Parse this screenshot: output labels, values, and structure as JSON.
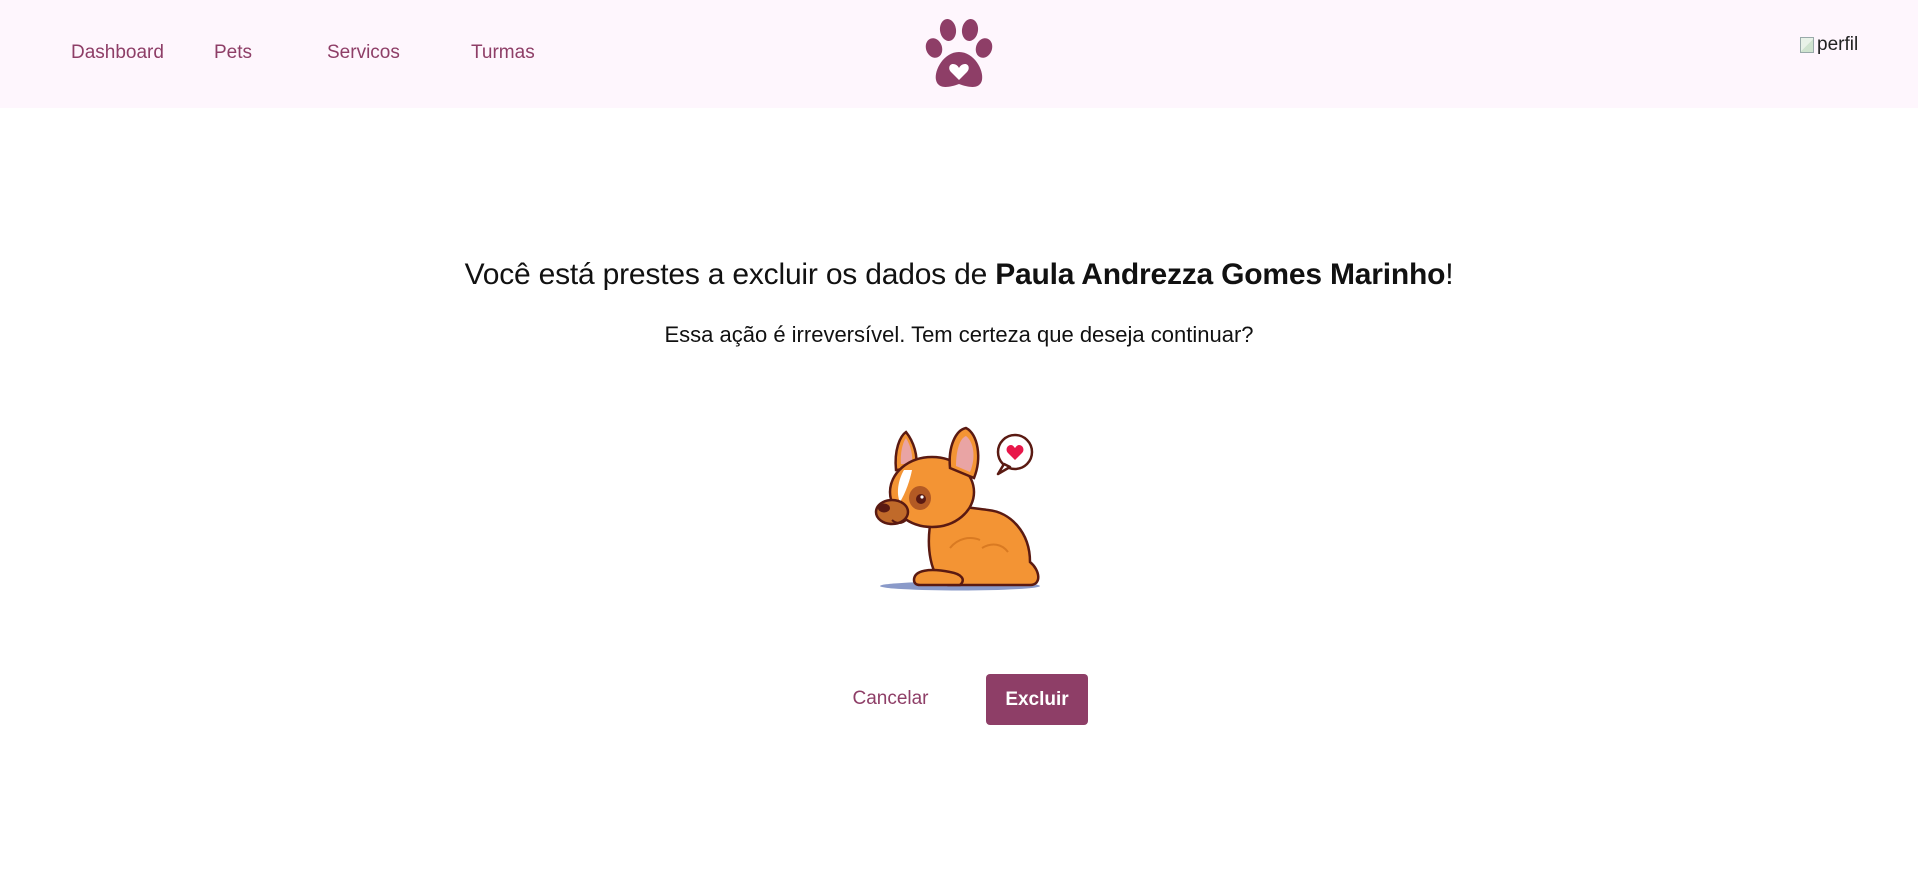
{
  "nav": {
    "items": [
      {
        "label": "Dashboard"
      },
      {
        "label": "Pets"
      },
      {
        "label": "Servicos"
      },
      {
        "label": "Turmas"
      }
    ],
    "logo_icon": "paw-heart-icon",
    "profile_alt": "perfil"
  },
  "dialog": {
    "title_prefix": "Você está prestes a excluir os dados de ",
    "person_name": "Paula Andrezza Gomes Marinho",
    "title_suffix": "!",
    "message": "Essa ação é irreversível. Tem certeza que deseja continuar?",
    "illustration_icon": "sad-dog-illustration",
    "cancel_label": "Cancelar",
    "delete_label": "Excluir"
  },
  "colors": {
    "brand": "#8e3e67",
    "nav_background": "#fef6fd"
  }
}
